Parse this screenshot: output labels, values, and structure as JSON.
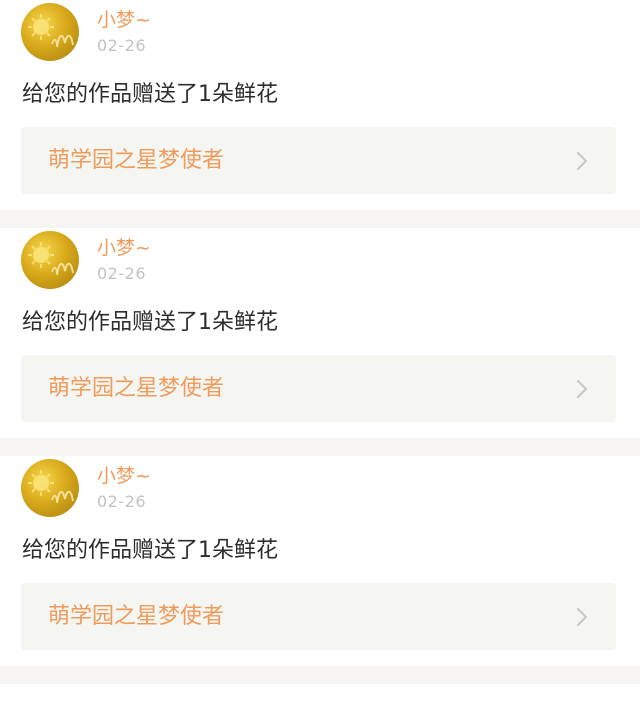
{
  "feed": {
    "items": [
      {
        "user": "小梦~",
        "date": "02-26",
        "message": "给您的作品赠送了1朵鲜花",
        "work_title": "萌学园之星梦使者",
        "avatar": "avatar-image",
        "chevron_icon": "chevron-right-icon"
      },
      {
        "user": "小梦~",
        "date": "02-26",
        "message": "给您的作品赠送了1朵鲜花",
        "work_title": "萌学园之星梦使者",
        "avatar": "avatar-image",
        "chevron_icon": "chevron-right-icon"
      },
      {
        "user": "小梦~",
        "date": "02-26",
        "message": "给您的作品赠送了1朵鲜花",
        "work_title": "萌学园之星梦使者",
        "avatar": "avatar-image",
        "chevron_icon": "chevron-right-icon"
      }
    ]
  },
  "colors": {
    "accent": "#ef9b5c",
    "date": "#c3c3c3",
    "text": "#2d2d2d",
    "card_bg": "#ffffff",
    "link_bg": "#f5f5f2",
    "separator": "#f7f4f4"
  }
}
